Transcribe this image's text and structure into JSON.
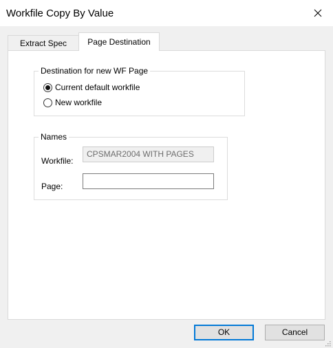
{
  "window": {
    "title": "Workfile Copy By Value",
    "close_icon": "close-icon"
  },
  "tabs": [
    {
      "label": "Extract Spec",
      "active": false
    },
    {
      "label": "Page Destination",
      "active": true
    }
  ],
  "destination": {
    "legend": "Destination for new WF Page",
    "options": [
      {
        "label": "Current default workfile",
        "selected": true
      },
      {
        "label": "New workfile",
        "selected": false
      }
    ]
  },
  "names": {
    "legend": "Names",
    "workfile_label": "Workfile:",
    "workfile_value": "CPSMAR2004 WITH PAGES",
    "page_label": "Page:",
    "page_value": ""
  },
  "buttons": {
    "ok": "OK",
    "cancel": "Cancel"
  },
  "colors": {
    "default_button_border": "#0078d7",
    "dialog_background": "#f0f0f0"
  }
}
